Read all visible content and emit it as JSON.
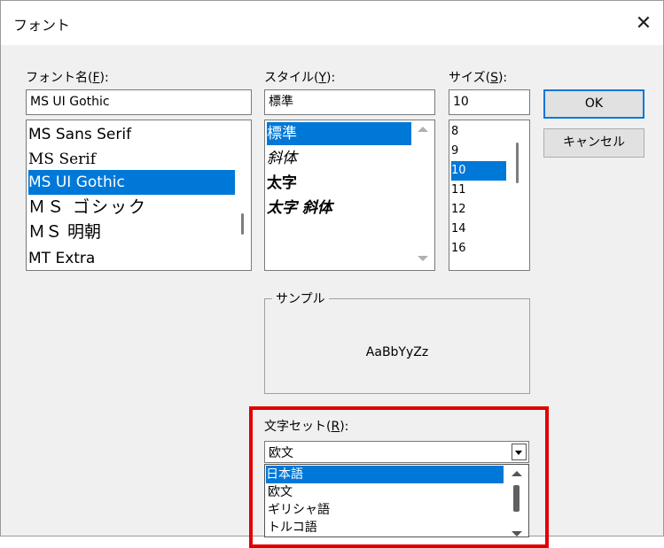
{
  "dialog": {
    "title": "フォント",
    "close_glyph": "✕"
  },
  "font_name": {
    "label": "フォント名",
    "accel": "F",
    "label_suffix": ":",
    "value": "MS UI Gothic",
    "items": [
      "MS Sans Serif",
      "MS Serif",
      "MS UI Gothic",
      "ＭＳ ゴシック",
      "ＭＳ 明朝",
      "MT Extra"
    ],
    "selected_index": 2
  },
  "style": {
    "label": "スタイル",
    "accel": "Y",
    "label_suffix": ":",
    "value": "標準",
    "items": [
      "標準",
      "斜体",
      "太字",
      "太字 斜体"
    ],
    "selected_index": 0
  },
  "size": {
    "label": "サイズ",
    "accel": "S",
    "label_suffix": ":",
    "value": "10",
    "items": [
      "8",
      "9",
      "10",
      "11",
      "12",
      "14",
      "16"
    ],
    "selected_index": 2
  },
  "buttons": {
    "ok": "OK",
    "cancel": "キャンセル"
  },
  "sample": {
    "label": "サンプル",
    "text": "AaBbYyZz"
  },
  "charset": {
    "label": "文字セット",
    "accel": "R",
    "label_suffix": ":",
    "value": "欧文",
    "items": [
      "日本語",
      "欧文",
      "ギリシャ語",
      "トルコ語"
    ],
    "selected_index": 0
  },
  "colors": {
    "selection": "#0078d7",
    "highlight_border": "#e00000",
    "dialog_bg": "#f0f0f0"
  }
}
